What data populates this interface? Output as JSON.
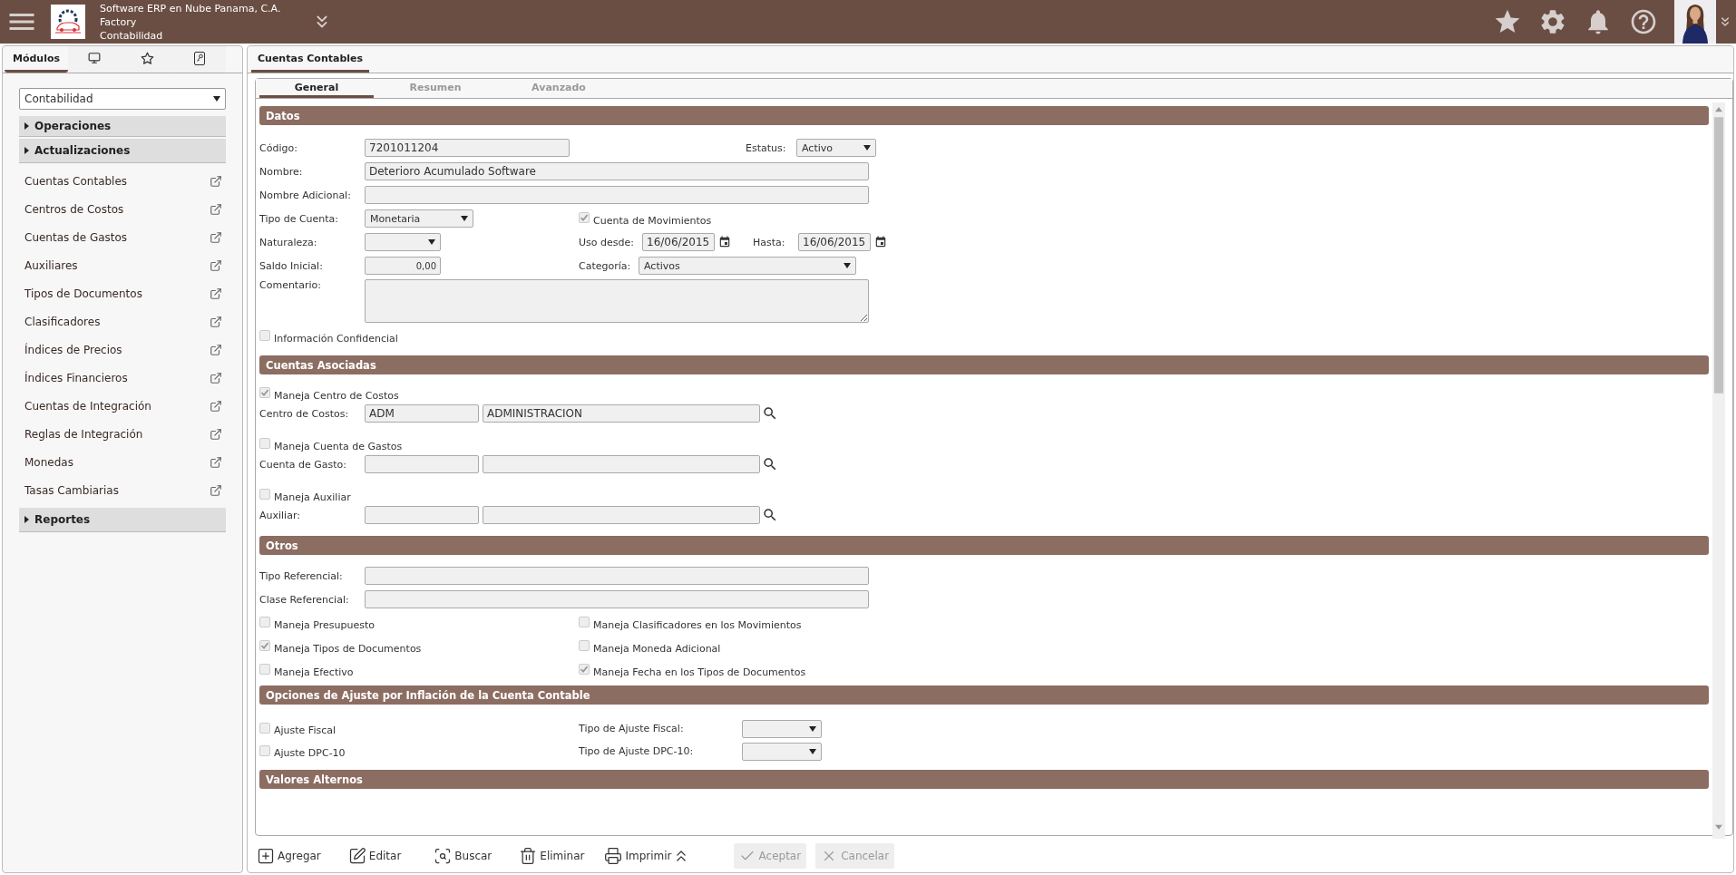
{
  "header": {
    "company": "Software ERP en Nube Panama, C.A.",
    "site": "Factory",
    "module": "Contabilidad"
  },
  "sidebar": {
    "tabs": [
      {
        "kind": "text",
        "label": "Módulos",
        "selected": true
      },
      {
        "kind": "monitor",
        "selected": false
      },
      {
        "kind": "star",
        "selected": false
      },
      {
        "kind": "key",
        "selected": false
      }
    ],
    "module_select": "Contabilidad",
    "groups": [
      {
        "label": "Operaciones"
      },
      {
        "label": "Actualizaciones",
        "items": [
          "Cuentas Contables",
          "Centros de Costos",
          "Cuentas de Gastos",
          "Auxiliares",
          "Tipos de Documentos",
          "Clasificadores",
          "Índices de Precios",
          "Índices Financieros",
          "Cuentas de Integración",
          "Reglas de Integración",
          "Monedas",
          "Tasas Cambiarias"
        ]
      },
      {
        "label": "Reportes"
      }
    ]
  },
  "main": {
    "tab": {
      "label": "Cuentas Contables",
      "selected": true
    },
    "subtabs": [
      {
        "label": "General",
        "selected": true
      },
      {
        "label": "Resumen",
        "selected": false
      },
      {
        "label": "Avanzado",
        "selected": false
      }
    ],
    "datos": {
      "title": "Datos",
      "codigo": {
        "label": "Código:",
        "value": "7201011204"
      },
      "estatus": {
        "label": "Estatus:",
        "value": "Activo"
      },
      "nombre": {
        "label": "Nombre:",
        "value": "Deterioro Acumulado Software"
      },
      "nombre_adicional": {
        "label": "Nombre Adicional:"
      },
      "tipo_cuenta": {
        "label": "Tipo de Cuenta:",
        "value": "Monetaria"
      },
      "cuenta_movimientos": {
        "label": "Cuenta de Movimientos",
        "checked": true
      },
      "naturaleza": {
        "label": "Naturaleza:"
      },
      "uso_desde": {
        "label": "Uso desde:",
        "value": "16/06/2015"
      },
      "hasta": {
        "label": "Hasta:",
        "value": "16/06/2015"
      },
      "saldo_inicial": {
        "label": "Saldo Inicial:",
        "value": "0,00"
      },
      "categoria": {
        "label": "Categoría:",
        "value": "Activos"
      },
      "comentario": {
        "label": "Comentario:"
      },
      "confidencial": {
        "label": "Información Confidencial",
        "checked": false
      }
    },
    "asociadas": {
      "title": "Cuentas Asociadas",
      "groups": [
        {
          "check": {
            "label": "Maneja Centro de Costos",
            "checked": true
          },
          "label": "Centro de Costos:",
          "code": "ADM",
          "name": "ADMINISTRACION"
        },
        {
          "check": {
            "label": "Maneja Cuenta de Gastos",
            "checked": false
          },
          "label": "Cuenta de Gasto:"
        },
        {
          "check": {
            "label": "Maneja Auxiliar",
            "checked": false
          },
          "label": "Auxiliar:"
        }
      ]
    },
    "otros": {
      "title": "Otros",
      "tipo_referencial": {
        "label": "Tipo Referencial:"
      },
      "clase_referencial": {
        "label": "Clase Referencial:"
      },
      "checks": [
        {
          "label": "Maneja Presupuesto",
          "checked": false
        },
        {
          "label": "Maneja Clasificadores en los Movimientos",
          "checked": false
        },
        {
          "label": "Maneja Tipos de Documentos",
          "checked": true
        },
        {
          "label": "Maneja Moneda Adicional",
          "checked": false
        },
        {
          "label": "Maneja Efectivo",
          "checked": false
        },
        {
          "label": "Maneja Fecha en los Tipos de Documentos",
          "checked": true
        }
      ]
    },
    "ajuste": {
      "title": "Opciones de Ajuste por Inflación de la Cuenta Contable",
      "rows": [
        {
          "check": {
            "label": "Ajuste Fiscal",
            "checked": false
          },
          "select_label": "Tipo de Ajuste Fiscal:"
        },
        {
          "check": {
            "label": "Ajuste DPC-10",
            "checked": false
          },
          "select_label": "Tipo de Ajuste DPC-10:"
        }
      ]
    },
    "valores": {
      "title": "Valores Alternos"
    }
  },
  "toolbar": {
    "tools": [
      {
        "kind": "add",
        "label": "Agregar"
      },
      {
        "kind": "edit",
        "label": "Editar"
      },
      {
        "kind": "find",
        "label": "Buscar"
      },
      {
        "kind": "delete",
        "label": "Eliminar"
      },
      {
        "kind": "print",
        "label": "Imprimir"
      },
      {
        "kind": "collapse"
      }
    ],
    "actions": [
      {
        "kind": "accept",
        "label": "Aceptar",
        "disabled": true
      },
      {
        "kind": "cancel",
        "label": "Cancelar",
        "disabled": true
      }
    ]
  }
}
